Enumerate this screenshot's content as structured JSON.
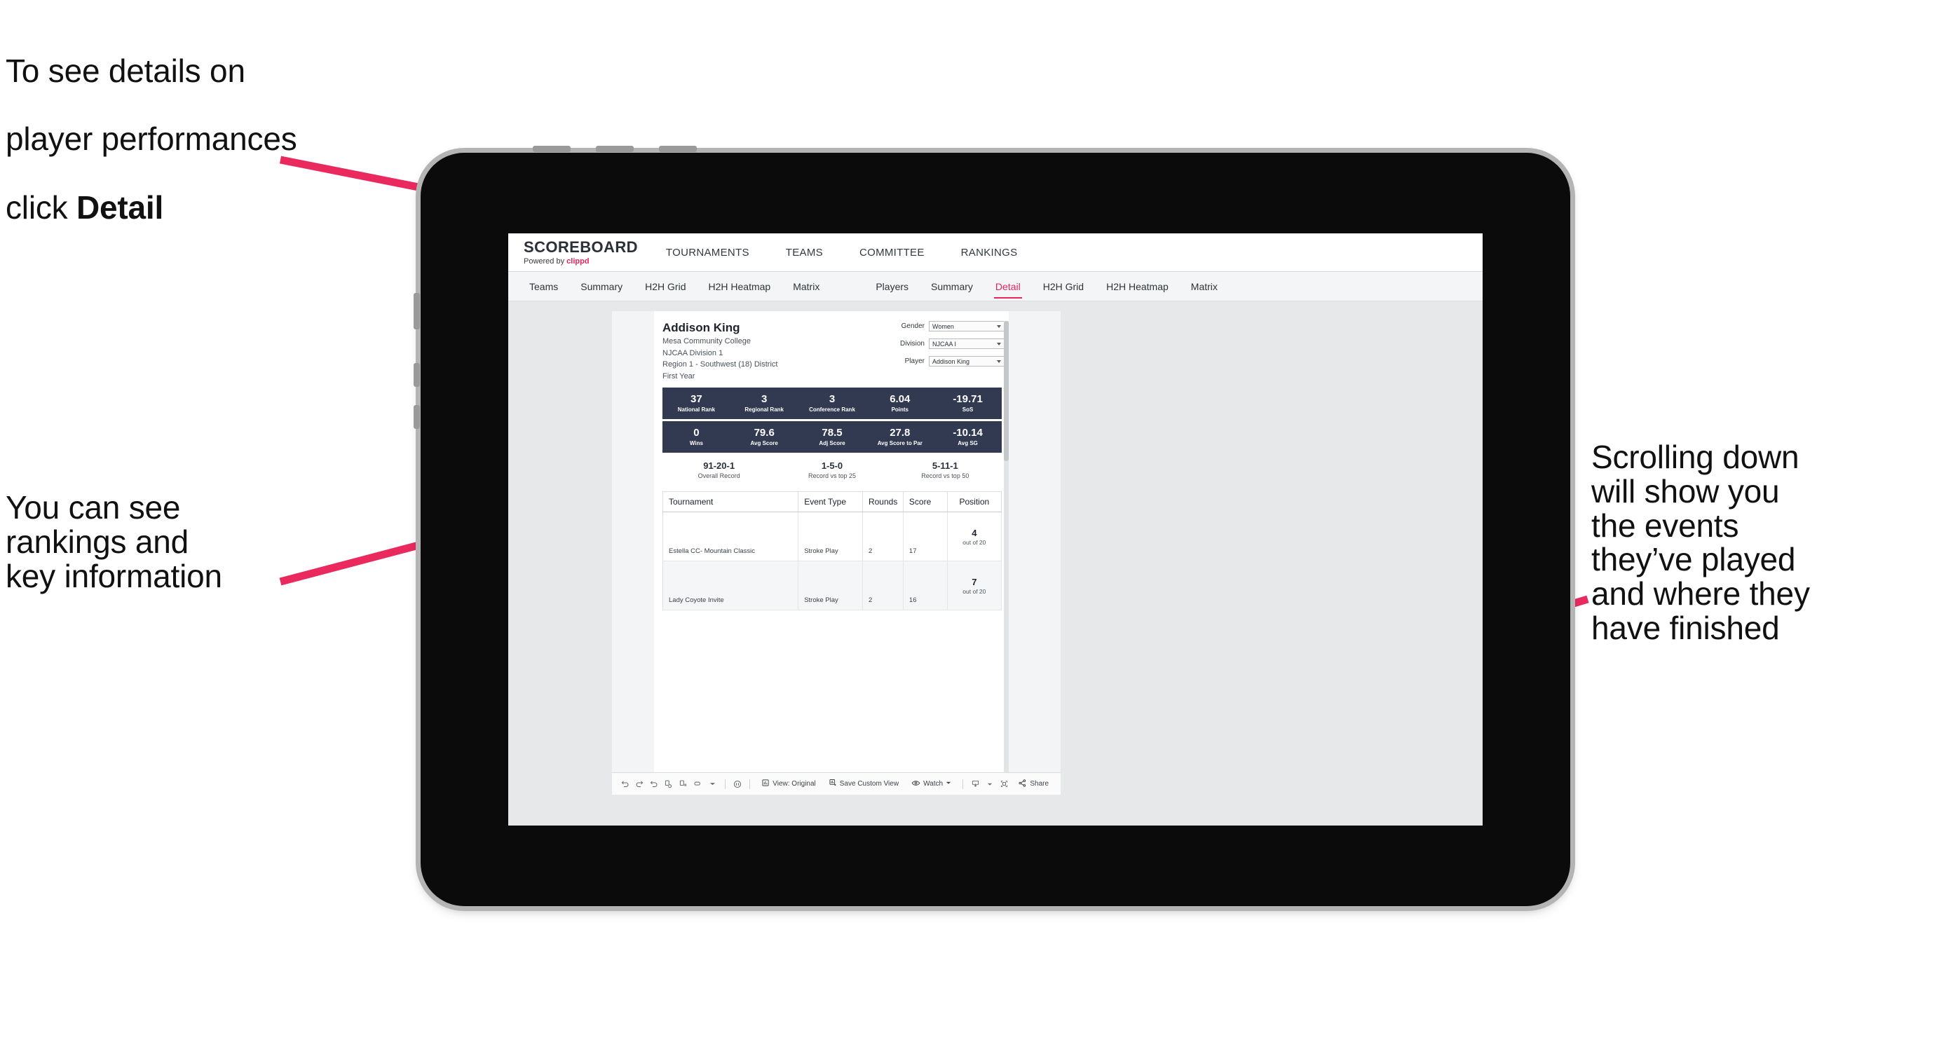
{
  "annotations": {
    "top_left_line1": "To see details on",
    "top_left_line2": "player performances",
    "top_left_line3_prefix": "click ",
    "top_left_line3_bold": "Detail",
    "mid_left": "You can see\nrankings and\nkey information",
    "right": "Scrolling down\nwill show you\nthe events\nthey’ve played\nand where they\nhave finished"
  },
  "colors": {
    "accent_pink": "#e8245c",
    "stat_band": "#323a52",
    "screen_bg": "#e6e8ea",
    "arrow": "#ea2a5f"
  },
  "app": {
    "brand": {
      "title": "SCOREBOARD",
      "powered_prefix": "Powered by ",
      "powered_brand": "clippd"
    },
    "top_nav": [
      {
        "label": "TOURNAMENTS"
      },
      {
        "label": "TEAMS"
      },
      {
        "label": "COMMITTEE"
      },
      {
        "label": "RANKINGS"
      }
    ],
    "tab_groups": [
      {
        "name": "teams-group",
        "tabs": [
          {
            "label": "Teams",
            "active": false
          },
          {
            "label": "Summary",
            "active": false
          },
          {
            "label": "H2H Grid",
            "active": false
          },
          {
            "label": "H2H Heatmap",
            "active": false
          },
          {
            "label": "Matrix",
            "active": false
          }
        ]
      },
      {
        "name": "players-group",
        "tabs": [
          {
            "label": "Players",
            "active": false
          },
          {
            "label": "Summary",
            "active": false
          },
          {
            "label": "Detail",
            "active": true
          },
          {
            "label": "H2H Grid",
            "active": false
          },
          {
            "label": "H2H Heatmap",
            "active": false
          },
          {
            "label": "Matrix",
            "active": false
          }
        ]
      }
    ],
    "player": {
      "name": "Addison King",
      "school": "Mesa Community College",
      "division": "NJCAA Division 1",
      "region": "Region 1 - Southwest (18) District",
      "year": "First Year"
    },
    "filters": [
      {
        "label": "Gender",
        "value": "Women"
      },
      {
        "label": "Division",
        "value": "NJCAA I"
      },
      {
        "label": "Player",
        "value": "Addison King"
      }
    ],
    "stats_row1": [
      {
        "value": "37",
        "label": "National Rank"
      },
      {
        "value": "3",
        "label": "Regional Rank"
      },
      {
        "value": "3",
        "label": "Conference Rank"
      },
      {
        "value": "6.04",
        "label": "Points"
      },
      {
        "value": "-19.71",
        "label": "SoS"
      }
    ],
    "stats_row2": [
      {
        "value": "0",
        "label": "Wins"
      },
      {
        "value": "79.6",
        "label": "Avg Score"
      },
      {
        "value": "78.5",
        "label": "Adj Score"
      },
      {
        "value": "27.8",
        "label": "Avg Score to Par"
      },
      {
        "value": "-10.14",
        "label": "Avg SG"
      }
    ],
    "records": [
      {
        "value": "91-20-1",
        "label": "Overall Record"
      },
      {
        "value": "1-5-0",
        "label": "Record vs top 25"
      },
      {
        "value": "5-11-1",
        "label": "Record vs top 50"
      }
    ],
    "table": {
      "headers": [
        "Tournament",
        "Event Type",
        "Rounds",
        "Score",
        "Position"
      ],
      "rows": [
        {
          "tournament": "Estella CC- Mountain Classic",
          "event_type": "Stroke Play",
          "rounds": "2",
          "score": "17",
          "position": "4",
          "position_out_of": "out of 20"
        },
        {
          "tournament": "Lady Coyote Invite",
          "event_type": "Stroke Play",
          "rounds": "2",
          "score": "16",
          "position": "7",
          "position_out_of": "out of 20"
        }
      ]
    },
    "toolbar": {
      "view_label": "View: Original",
      "save_label": "Save Custom View",
      "watch_label": "Watch",
      "share_label": "Share"
    }
  }
}
